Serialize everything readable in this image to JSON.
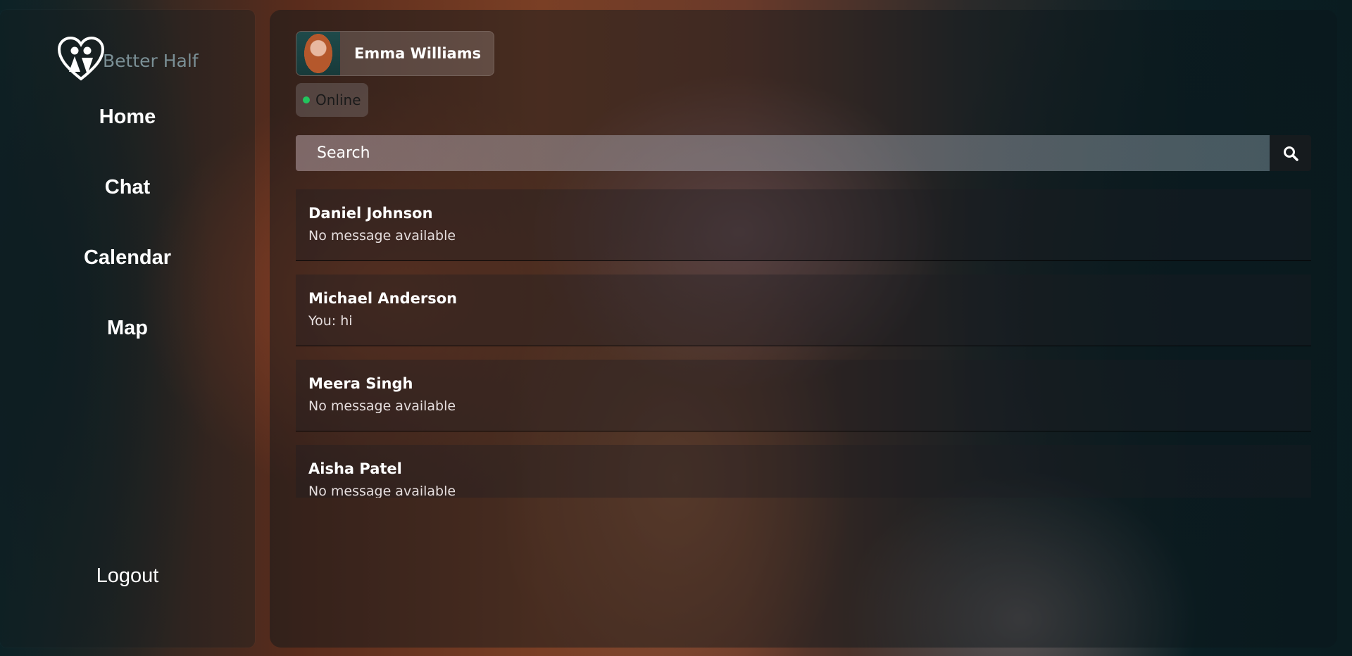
{
  "app": {
    "name": "Better Half"
  },
  "sidebar": {
    "nav": [
      {
        "label": "Home"
      },
      {
        "label": "Chat"
      },
      {
        "label": "Calendar"
      },
      {
        "label": "Map"
      }
    ],
    "logout_label": "Logout"
  },
  "profile": {
    "name": "Emma Williams",
    "status": "Online",
    "status_color": "#22c55e"
  },
  "search": {
    "placeholder": "Search",
    "button_icon": "search-icon"
  },
  "conversations": [
    {
      "name": "Daniel Johnson",
      "last_message": "No message available"
    },
    {
      "name": "Michael Anderson",
      "last_message": "You: hi"
    },
    {
      "name": "Meera Singh",
      "last_message": "No message available"
    },
    {
      "name": "Aisha Patel",
      "last_message": "No message available"
    }
  ]
}
